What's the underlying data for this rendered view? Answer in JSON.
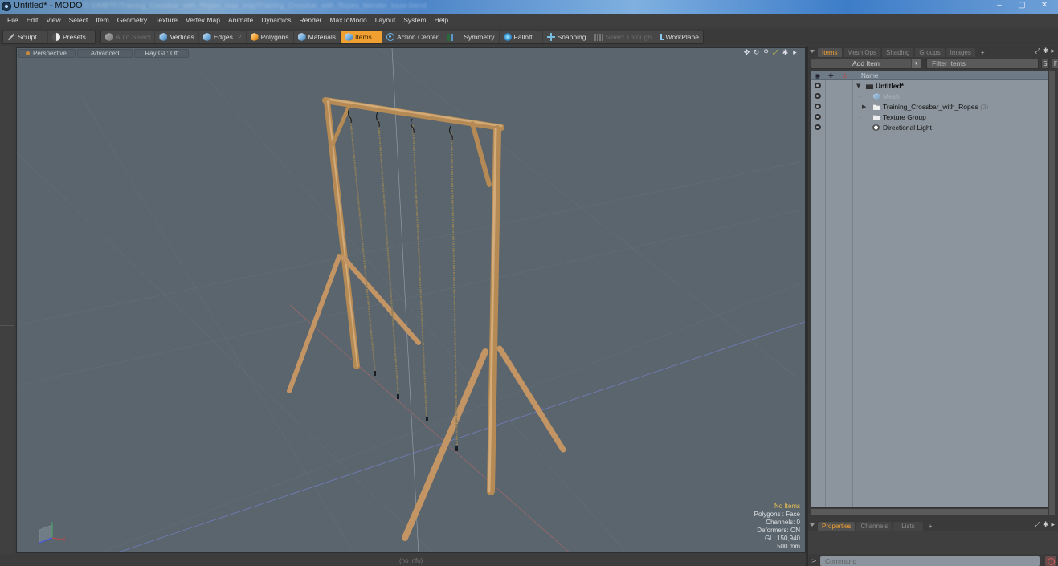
{
  "window": {
    "title": "Untitled* - MODO",
    "path_blurred": "C:\\DMBTF\\Training_Crossbar_with_Ropes_max_vray\\Training_Crossbar_with_Ropes_blender_base.blend",
    "minimize": "–",
    "maximize": "▢",
    "close": "✕"
  },
  "menu": [
    "File",
    "Edit",
    "View",
    "Select",
    "Item",
    "Geometry",
    "Texture",
    "Vertex Map",
    "Animate",
    "Dynamics",
    "Render",
    "MaxToModo",
    "Layout",
    "System",
    "Help"
  ],
  "toolbar": {
    "sculpt": "Sculpt",
    "presets": "Presets",
    "auto_select": "Auto Select",
    "vertices": "Vertices",
    "edges": "Edges",
    "edges_badge": "2",
    "polygons": "Polygons",
    "materials": "Materials",
    "items": "Items",
    "action_center": "Action Center",
    "symmetry": "Symmetry",
    "falloff": "Falloff",
    "snapping": "Snapping",
    "select_through": "Select Through",
    "workplane": "WorkPlane",
    "accent": "#f0a030"
  },
  "viewport": {
    "tabs": [
      "Perspective",
      "Advanced",
      "Ray GL: Off"
    ],
    "tools": [
      "move-view",
      "rotate-view",
      "zoom-view",
      "fit-view",
      "settings",
      "more"
    ],
    "info": {
      "selection": "No Items",
      "polygons": "Polygons : Face",
      "channels": "Channels: 0",
      "deformers": "Deformers: ON",
      "gl": "GL: 150,940",
      "scale": "500 mm"
    },
    "axis_labels": {
      "x": "X",
      "y": "Y",
      "z": "Z"
    }
  },
  "status": {
    "info": "(no info)"
  },
  "items_panel": {
    "tabs": [
      "Items",
      "Mesh Ops",
      "Shading",
      "Groups",
      "Images",
      "+"
    ],
    "active_tab": "Items",
    "add_item": "Add Item",
    "filter_placeholder": "Filter Items",
    "s_btn": "S",
    "f_btn": "F",
    "column_name": "Name",
    "tree": [
      {
        "label": "Untitled*",
        "level": 0,
        "bold": true,
        "expanded": true,
        "icon": "scene-icon"
      },
      {
        "label": "Mesh",
        "level": 1,
        "dim": true,
        "icon": "mesh-icon"
      },
      {
        "label": "Training_Crossbar_with_Ropes",
        "count": "(3)",
        "level": 1,
        "collapsed": true,
        "icon": "group-icon"
      },
      {
        "label": "Texture Group",
        "level": 1,
        "icon": "group-icon"
      },
      {
        "label": "Directional Light",
        "level": 1,
        "icon": "light-icon"
      }
    ]
  },
  "bottom_panel": {
    "tabs": [
      "Properties",
      "Channels",
      "Lists",
      "+"
    ],
    "active_tab": "Properties",
    "command_prompt": ">",
    "command_placeholder": "Command"
  }
}
